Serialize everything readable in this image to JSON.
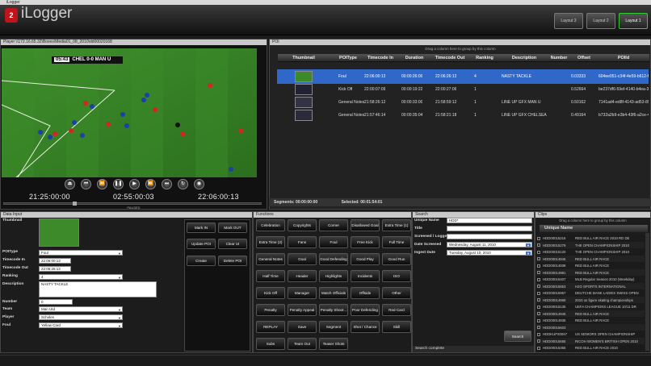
{
  "window_title": "iLogger",
  "app": {
    "logo_text": "2",
    "name": "iLogger"
  },
  "layouts": [
    "Layout 3",
    "Layout 2",
    "Layout 1"
  ],
  "player": {
    "title": "Player \\\\172.16.65.32\\Boxes\\Media01_08_2010\\dd00020168",
    "score": {
      "time": "05:43",
      "text": "CHEL 0-0 MAN U"
    },
    "time_in": "21:25:00:00",
    "duration": "02:55:00:03",
    "time_out": "22:06:00:13",
    "state": "PAUSED",
    "progress": 0.27
  },
  "poi": {
    "title": "POI",
    "drag_msg": "Drag a column here to group by this column",
    "columns": [
      "Thumbnail",
      "POIType",
      "Timecode In",
      "Duration",
      "Timecode Out",
      "Ranking",
      "Description",
      "Number",
      "Offset",
      "POIId"
    ],
    "rows": [
      {
        "type": "Foul",
        "tc_in": "22:06:00:13",
        "duration": "00:00:26:00",
        "tc_out": "22:06:26:13",
        "ranking": "4",
        "description": "NASTY TACKLE",
        "number": "",
        "offset": "0.03333",
        "id": "604ee051-c34f-4e59-b612-f67"
      },
      {
        "type": "Kick Off",
        "tc_in": "22:00:07:09",
        "duration": "00:00:19:22",
        "tc_out": "22:00:27:06",
        "ranking": "1",
        "description": "",
        "number": "",
        "offset": "0.52664",
        "id": "be237df6-59ef-4140-b4ea-3d5e"
      },
      {
        "type": "General Notes",
        "tc_in": "21:58:26:12",
        "duration": "00:00:33:00",
        "tc_out": "21:58:59:12",
        "ranking": "1",
        "description": "LINE UP GFX MAN U",
        "number": "",
        "offset": "0.50162",
        "id": "7141ad4-ed8f-4143-ad53-8984"
      },
      {
        "type": "General Notes",
        "tc_in": "21:57:46:14",
        "duration": "00:00:35:04",
        "tc_out": "21:58:21:18",
        "ranking": "1",
        "description": "LINE UP GFX CHELSEA",
        "number": "",
        "offset": "0.49164",
        "id": "b732a2b9-e3b4-43f6-a2ce-448ea"
      }
    ],
    "segments_label": "Segments: 00:00:00:00",
    "selected_label": "Selected: 00:01:54:01"
  },
  "data_input": {
    "title": "Data Input",
    "labels": {
      "thumbnail": "Thumbnail",
      "poitype": "POIType",
      "tc_in": "Timecode In",
      "tc_out": "Timecode Out",
      "ranking": "Ranking",
      "description": "Description",
      "number": "Number",
      "team": "Team",
      "player": "Player",
      "foul": "Foul"
    },
    "values": {
      "poitype": "Foul",
      "tc_in": "22:06:00:13",
      "tc_out": "22:06:26:13",
      "ranking": "4",
      "description": "NASTY TACKLE",
      "number": "0",
      "team": "Man Utd",
      "player": "Scholes",
      "foul": "Yellow Card"
    },
    "buttons": [
      "Mark IN",
      "Mark OUT",
      "Update POI",
      "Clear UI",
      "Create",
      "Delete POI"
    ]
  },
  "functions": {
    "title": "Functions",
    "buttons": [
      "Celebration",
      "Copyrights",
      "Corner",
      "Disallowed Goal",
      "Extra Time (1)",
      "Extra Time (2)",
      "Fans",
      "Foul",
      "Free Kick",
      "Full Time",
      "General Notes",
      "Goal",
      "Good Defending",
      "Good Play",
      "Good Run",
      "Half Time",
      "Header",
      "Highlights",
      "Incidents",
      "ISO",
      "Kick Off",
      "Manager",
      "Match Officials",
      "Offside",
      "Other",
      "Penalty",
      "Penalty Appeal",
      "Penalty Shoot...",
      "Poor Defending",
      "Red Card",
      "REPLAY",
      "Save",
      "Segment",
      "Shot / Chance",
      "Skill",
      "Subs",
      "Team Out",
      "Teaser Shots"
    ]
  },
  "search": {
    "title": "Search",
    "labels": {
      "unique_name": "Unique Name",
      "title": "Title",
      "screened": "Screened / Logge",
      "date_screened": "Date Screened",
      "ingest_date": "Ingest Date"
    },
    "values": {
      "unique_name": "HDD*",
      "title": "",
      "screened": "",
      "date_screened": "Wednesday, August 11, 2010",
      "ingest_date": "Tuesday, August 10, 2010"
    },
    "button": "Search",
    "status": "Search complete"
  },
  "clips": {
    "title": "Clips",
    "drag_msg": "Drag a column here to group by this column",
    "column": "Unique Name",
    "rows": [
      {
        "id": "HDD00015216",
        "name": "RED BULL AIR RACE 2010 RD DE"
      },
      {
        "id": "HDD00015279",
        "name": "THE OPEN CHAMPIONSHIP 2010"
      },
      {
        "id": "HDD00015120",
        "name": "THE OPEN CHAMPIONSHIP 2010"
      },
      {
        "id": "HDD00014946",
        "name": "RED BULL AIR RACE"
      },
      {
        "id": "HDD00014938",
        "name": "RED BULL AIR RACE"
      },
      {
        "id": "HDD00014981",
        "name": "RED BULL AIR RACE"
      },
      {
        "id": "HDD00015407",
        "name": "MLB Regular Season 2010 (Weekday)"
      },
      {
        "id": "HDD00015853",
        "name": "H2O SPORTS INTERNATIONAL"
      },
      {
        "id": "HDD00015957",
        "name": "DEUTCHE BANK LADIES SWISS OPEN"
      },
      {
        "id": "HDD00014969",
        "name": "2010 us figure skating championships"
      },
      {
        "id": "HDD00015135",
        "name": "UEFA CHAMPIONS LEAGUE 10/11 DR"
      },
      {
        "id": "HDD00014945",
        "name": "RED BULL AIR RACE"
      },
      {
        "id": "HDD00014935",
        "name": "RED BULL AIR RACE"
      },
      {
        "id": "HDD00015603",
        "name": ""
      },
      {
        "id": "HDDKUP20067",
        "name": "US SENIORS OPEN CHAMPIONSHIP"
      },
      {
        "id": "HDD00015655",
        "name": "RICOH WOMEN'S BRITISH OPEN 2010"
      },
      {
        "id": "HDD00015355",
        "name": "RED BULL AIR RACE 2010"
      }
    ]
  }
}
